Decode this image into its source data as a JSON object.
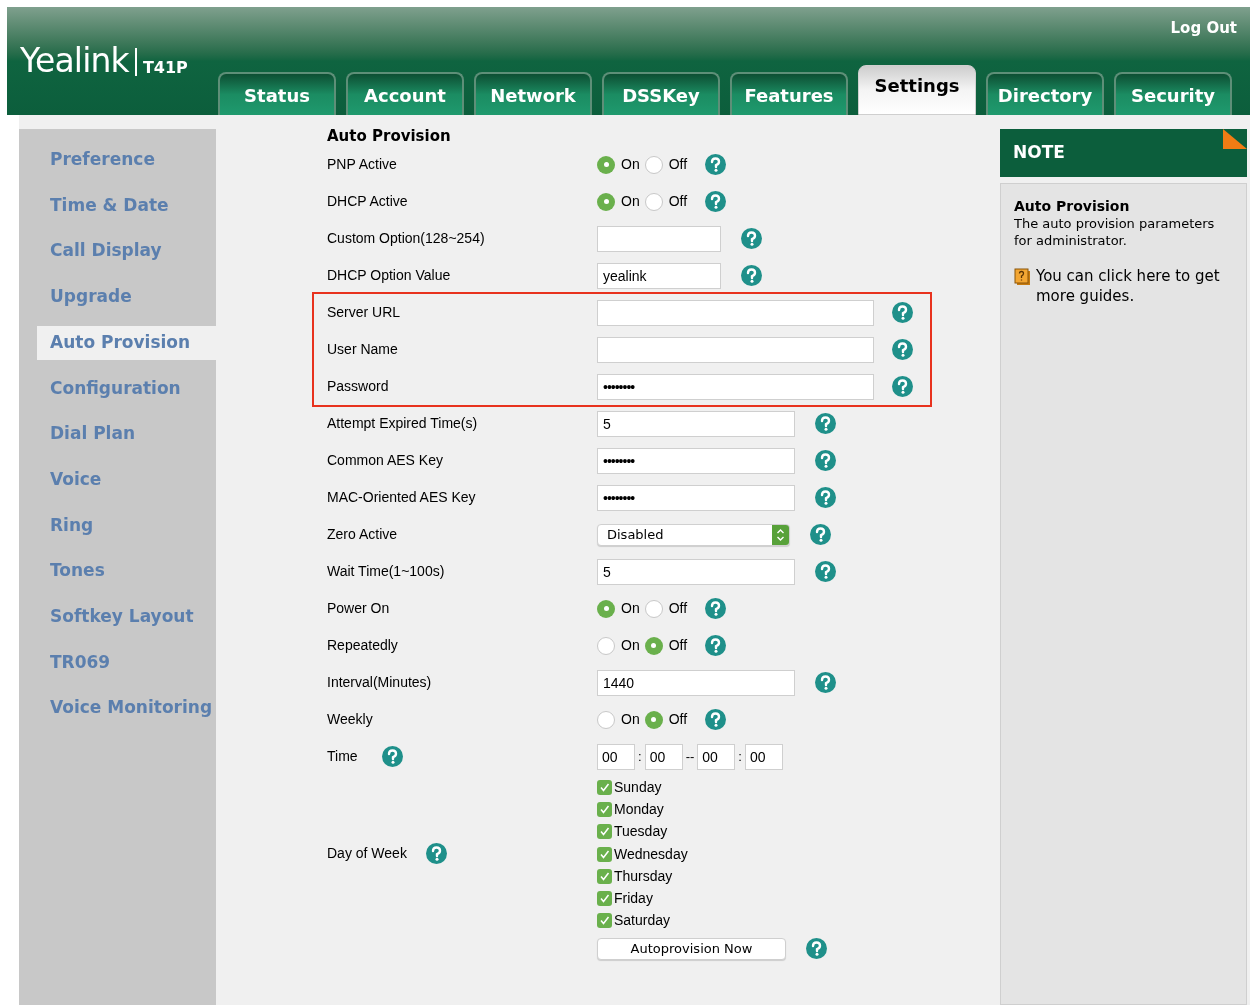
{
  "header": {
    "logo": "Yealink",
    "model": "T41P",
    "logout": "Log Out"
  },
  "tabs": [
    {
      "label": "Status",
      "selected": false
    },
    {
      "label": "Account",
      "selected": false
    },
    {
      "label": "Network",
      "selected": false
    },
    {
      "label": "DSSKey",
      "selected": false
    },
    {
      "label": "Features",
      "selected": false
    },
    {
      "label": "Settings",
      "selected": true
    },
    {
      "label": "Directory",
      "selected": false
    },
    {
      "label": "Security",
      "selected": false
    }
  ],
  "sidebar": {
    "items": [
      {
        "label": "Preference",
        "selected": false
      },
      {
        "label": "Time & Date",
        "selected": false
      },
      {
        "label": "Call Display",
        "selected": false
      },
      {
        "label": "Upgrade",
        "selected": false
      },
      {
        "label": "Auto Provision",
        "selected": true
      },
      {
        "label": "Configuration",
        "selected": false
      },
      {
        "label": "Dial Plan",
        "selected": false
      },
      {
        "label": "Voice",
        "selected": false
      },
      {
        "label": "Ring",
        "selected": false
      },
      {
        "label": "Tones",
        "selected": false
      },
      {
        "label": "Softkey Layout",
        "selected": false
      },
      {
        "label": "TR069",
        "selected": false
      },
      {
        "label": "Voice Monitoring",
        "selected": false
      }
    ]
  },
  "form": {
    "title": "Auto Provision",
    "rows": [
      {
        "kind": "radio",
        "label": "PNP Active",
        "options": [
          {
            "label": "On",
            "selected": true
          },
          {
            "label": "Off",
            "selected": false
          }
        ],
        "highlighted": false
      },
      {
        "kind": "radio",
        "label": "DHCP Active",
        "options": [
          {
            "label": "On",
            "selected": true
          },
          {
            "label": "Off",
            "selected": false
          }
        ],
        "highlighted": false
      },
      {
        "kind": "shortfield",
        "label": "Custom Option(128~254)",
        "highlighted": false
      },
      {
        "kind": "shortfield",
        "label": "DHCP Option Value",
        "value": "yealink",
        "highlighted": false
      },
      {
        "kind": "longfield",
        "label": "Server URL",
        "highlighted": true
      },
      {
        "kind": "longfield",
        "label": "User Name",
        "highlighted": true
      },
      {
        "kind": "longsecret",
        "label": "Password",
        "value": "••••••••",
        "highlighted": true
      },
      {
        "kind": "mediumfield",
        "label": "Attempt Expired Time(s)",
        "value": "5",
        "highlighted": false
      },
      {
        "kind": "mediumsecret",
        "label": "Common AES Key",
        "value": "••••••••",
        "highlighted": false
      },
      {
        "kind": "mediumsecret",
        "label": "MAC-Oriented AES Key",
        "value": "••••••••",
        "highlighted": false
      },
      {
        "kind": "select",
        "label": "Zero Active",
        "value": "Disabled",
        "highlighted": false
      },
      {
        "kind": "mediumfield",
        "label": "Wait Time(1~100s)",
        "value": "5",
        "highlighted": false
      },
      {
        "kind": "radio",
        "label": "Power On",
        "options": [
          {
            "label": "On",
            "selected": true
          },
          {
            "label": "Off",
            "selected": false
          }
        ],
        "highlighted": false
      },
      {
        "kind": "radio",
        "label": "Repeatedly",
        "options": [
          {
            "label": "On",
            "selected": false
          },
          {
            "label": "Off",
            "selected": true
          }
        ],
        "highlighted": false
      },
      {
        "kind": "mediumfield",
        "label": "Interval(Minutes)",
        "value": "1440",
        "highlighted": false
      },
      {
        "kind": "radio",
        "label": "Weekly",
        "options": [
          {
            "label": "On",
            "selected": false
          },
          {
            "label": "Off",
            "selected": true
          }
        ],
        "highlighted": false
      },
      {
        "kind": "time",
        "label": "Time",
        "fields": [
          "00",
          "00",
          "00",
          "00"
        ],
        "separators": [
          ":",
          "--",
          ":"
        ],
        "highlighted": false
      },
      {
        "kind": "days",
        "label": "Day of Week",
        "days": [
          {
            "label": "Sunday",
            "checked": true
          },
          {
            "label": "Monday",
            "checked": true
          },
          {
            "label": "Tuesday",
            "checked": true
          },
          {
            "label": "Wednesday",
            "checked": true
          },
          {
            "label": "Thursday",
            "checked": true
          },
          {
            "label": "Friday",
            "checked": true
          },
          {
            "label": "Saturday",
            "checked": true
          }
        ],
        "highlighted": false
      },
      {
        "kind": "button",
        "label": "Autoprovision Now",
        "highlighted": false
      }
    ]
  },
  "note": {
    "title": "NOTE",
    "heading": "Auto Provision",
    "text": "The auto provision parameters for administrator.",
    "guide": "You can click here to get more guides."
  }
}
